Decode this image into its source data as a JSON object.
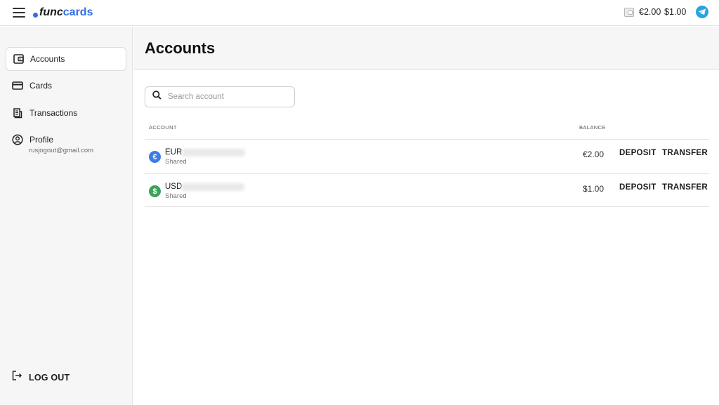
{
  "header": {
    "brand_func": "func",
    "brand_cards": "cards",
    "balance_eur": "€2.00",
    "balance_usd": "$1.00",
    "icons": [
      "menu-icon",
      "wallet-icon",
      "telegram-icon"
    ]
  },
  "sidebar": {
    "items": [
      {
        "label": "Accounts",
        "icon": "wallet-icon",
        "active": true
      },
      {
        "label": "Cards",
        "icon": "credit-card-icon",
        "active": false
      },
      {
        "label": "Transactions",
        "icon": "receipt-icon",
        "active": false
      },
      {
        "label": "Profile",
        "icon": "user-circle-icon",
        "active": false
      }
    ],
    "profile_email": "rusjogout@gmail.com",
    "logout_label": "LOG OUT"
  },
  "page": {
    "title": "Accounts",
    "search_placeholder": "Search account"
  },
  "table": {
    "columns": [
      "ACCOUNT",
      "BALANCE"
    ],
    "rows": [
      {
        "currency": "EUR",
        "symbol": "€",
        "type": "Shared",
        "balance": "€2.00",
        "deposit": "DEPOSIT",
        "transfer": "TRANSFER"
      },
      {
        "currency": "USD",
        "symbol": "$",
        "type": "Shared",
        "balance": "$1.00",
        "deposit": "DEPOSIT",
        "transfer": "TRANSFER"
      }
    ]
  },
  "colors": {
    "accent": "#2f6fe4",
    "eur_icon": "#3d7bea",
    "usd_icon": "#3aa35a",
    "telegram": "#2aa3e0"
  }
}
